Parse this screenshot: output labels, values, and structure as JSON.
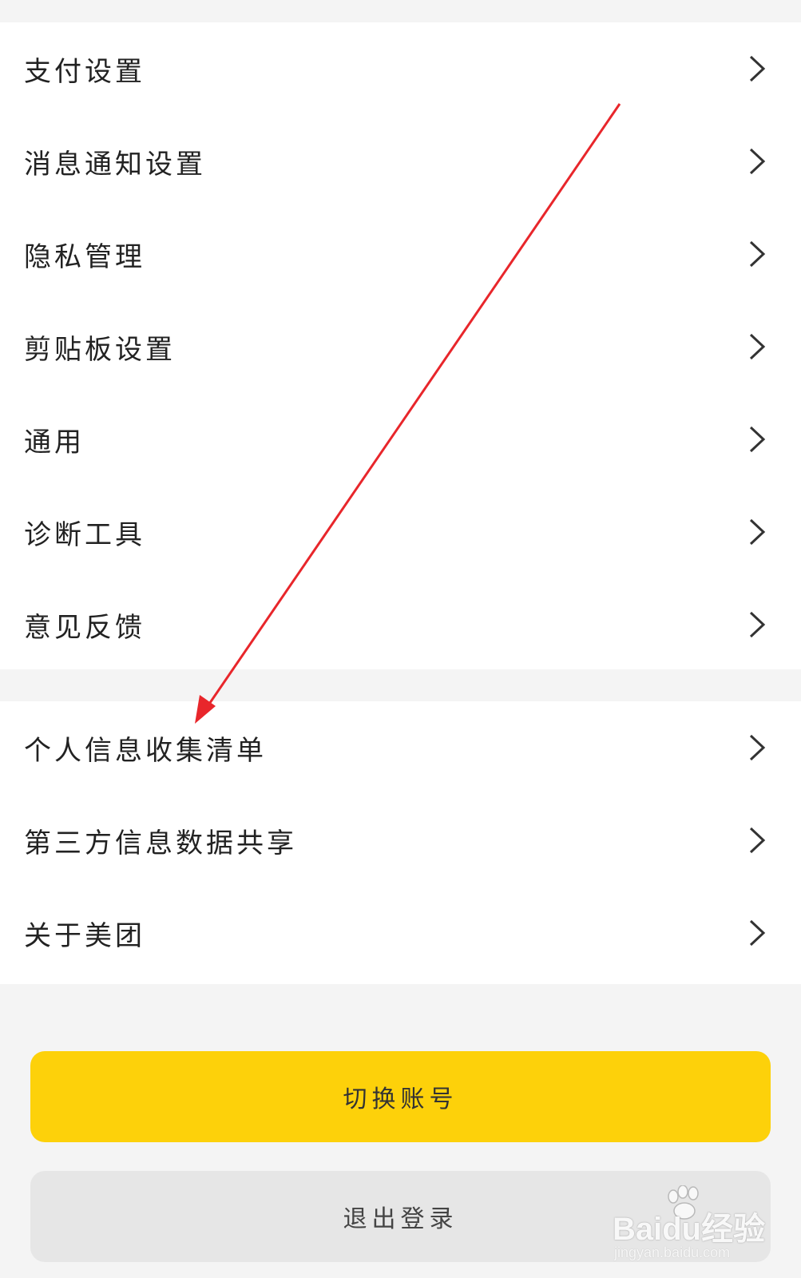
{
  "settings_group_1": [
    {
      "label": "支付设置"
    },
    {
      "label": "消息通知设置"
    },
    {
      "label": "隐私管理"
    },
    {
      "label": "剪贴板设置"
    },
    {
      "label": "通用"
    },
    {
      "label": "诊断工具"
    },
    {
      "label": "意见反馈"
    }
  ],
  "settings_group_2": [
    {
      "label": "个人信息收集清单"
    },
    {
      "label": "第三方信息数据共享"
    },
    {
      "label": "关于美团"
    }
  ],
  "buttons": {
    "switch_account": "切换账号",
    "logout": "退出登录"
  },
  "icons": {
    "row_chevron": "chevron-right-icon",
    "annotation": "red-arrow"
  },
  "watermark": {
    "brand": "Baidu经验",
    "url": "jingyan.baidu.com"
  },
  "colors": {
    "primary_button": "#fdd10a",
    "secondary_button": "#e6e6e6",
    "annotation_arrow": "#e8262b",
    "page_background": "#f4f4f4"
  }
}
